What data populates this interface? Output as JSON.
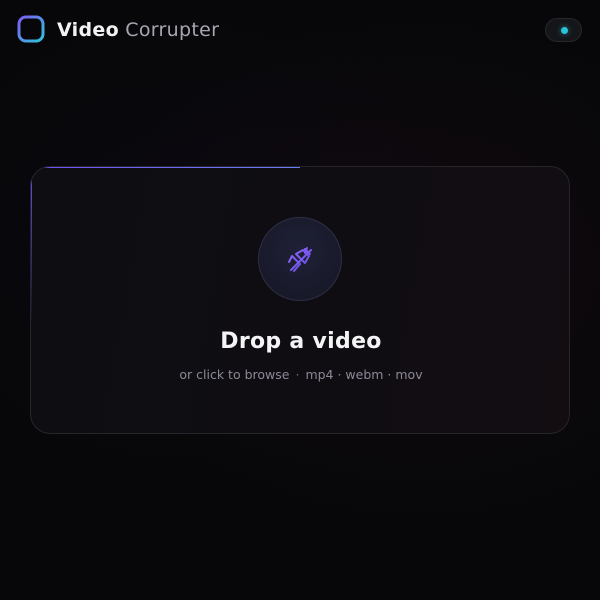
{
  "app": {
    "title_bold": "Video",
    "title_light": "Corrupter",
    "logo_icon": "rounded-square-logo-icon",
    "status_icon": "status-dot-icon",
    "status_color": "#2bc3d6"
  },
  "dropzone": {
    "icon": "crossed-bell-icon",
    "title": "Drop a video",
    "browse_text": "or click to browse",
    "separator": "·",
    "formats": "mp4 · webm · mov",
    "progress_fraction": 0.5,
    "accent_color": "#6d4ff0"
  }
}
